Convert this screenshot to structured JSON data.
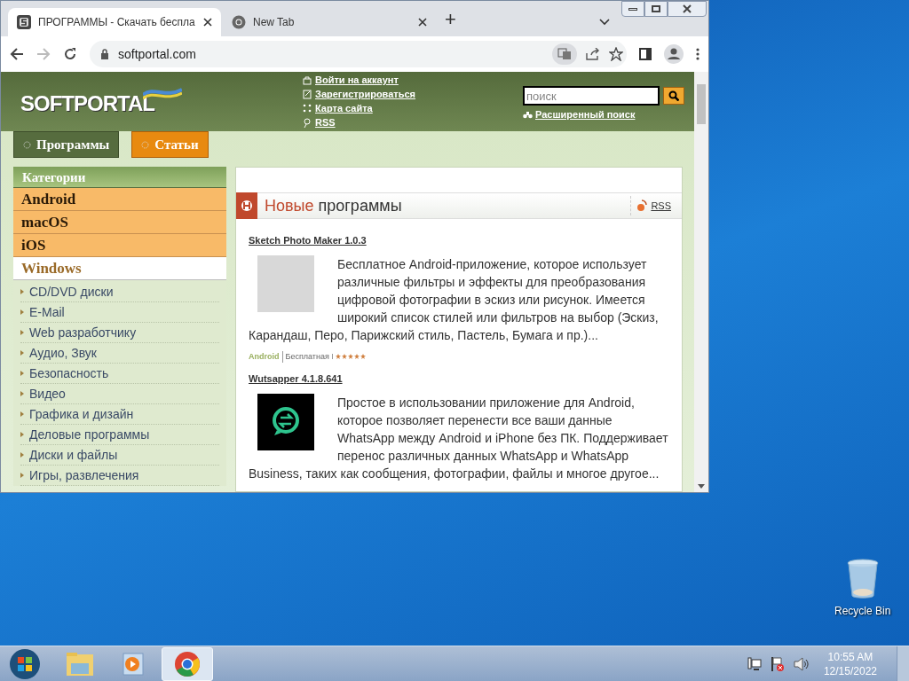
{
  "browser": {
    "tabs": [
      {
        "title": "ПРОГРАММЫ - Скачать беспла",
        "selected": true
      },
      {
        "title": "New Tab",
        "selected": false
      }
    ],
    "address": "softportal.com",
    "new_tab_button": "+"
  },
  "site": {
    "logo": "SOFTPORTAL",
    "header_links": [
      "Войти на аккаунт",
      "Зарегистрироваться",
      "Карта сайта",
      "RSS"
    ],
    "search": {
      "placeholder": "поиск"
    },
    "advanced_search": "Расширенный поиск",
    "nav": [
      {
        "label": "Программы",
        "selected": true
      },
      {
        "label": "Статьи",
        "selected": false
      }
    ],
    "sidebar": {
      "heading": "Категории",
      "platforms": [
        {
          "label": "Android",
          "selected": false
        },
        {
          "label": "macOS",
          "selected": false
        },
        {
          "label": "iOS",
          "selected": false
        },
        {
          "label": "Windows",
          "selected": true
        }
      ],
      "categories": [
        "CD/DVD диски",
        "E-Mail",
        "Web разработчику",
        "Аудио, Звук",
        "Безопасность",
        "Видео",
        "Графика и дизайн",
        "Деловые программы",
        "Диски и файлы",
        "Игры, развлечения"
      ]
    },
    "section": {
      "title_accent": "Новые",
      "title_rest": "программы",
      "rss": "RSS"
    },
    "programs": [
      {
        "kind": "photo",
        "title": "Sketch Photo Maker 1.0.3",
        "description": "Бесплатное Android-приложение, которое использует различные фильтры и эффекты для преобразования цифровой фотографии в эскиз или рисунок. Имеется широкий список стилей или фильтров на выбор (Эскиз, Карандаш, Перо, Парижский стиль, Пастель, Бумага и пр.)...",
        "platform": "Android",
        "license": "Бесплатная",
        "stars": 5
      },
      {
        "kind": "app",
        "title": "Wutsapper 4.1.8.641",
        "description": "Простое в использовании приложение для Android, которое позволяет перенести все ваши данные WhatsApp между Android и iPhone без ПК. Поддерживает перенос различных данных WhatsApp и WhatsApp Business, таких как сообщения, фотографии, файлы и многое другое..."
      }
    ]
  },
  "desktop": {
    "icons": [
      "Recycle Bin"
    ]
  },
  "taskbar": {
    "time": "10:55 AM",
    "date": "12/15/2022"
  }
}
